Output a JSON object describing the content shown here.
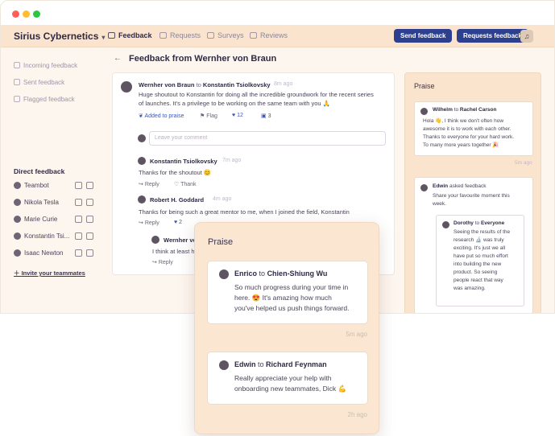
{
  "colors": {
    "accent": "#2d3f8f",
    "nav_bg": "#fbe4cd",
    "page_bg": "#fdf6ef",
    "window_dots": [
      "#ff5f57",
      "#febc2e",
      "#28c840"
    ]
  },
  "topnav": {
    "brand": "Sirius Cybernetics",
    "items": [
      {
        "label": "Feedback",
        "icon": "chat-icon"
      },
      {
        "label": "Requests",
        "icon": "cube-icon"
      },
      {
        "label": "Surveys",
        "icon": "survey-icon"
      },
      {
        "label": "Reviews",
        "icon": "list-icon"
      }
    ],
    "send_feedback": "Send feedback",
    "requests_feedback": "Requests feedback"
  },
  "sidebar": {
    "items": [
      {
        "label": "Incoming feedback",
        "icon": "inbox-icon"
      },
      {
        "label": "Sent feedback",
        "icon": "send-icon"
      },
      {
        "label": "Flagged feedback",
        "icon": "flag-icon"
      }
    ],
    "direct_heading": "Direct feedback",
    "people": [
      "Teambot",
      "Nikola Tesla",
      "Marie Curie",
      "Konstantin Tsi...",
      "Isaac Newton"
    ],
    "invite": "Invite your teammates"
  },
  "main": {
    "title": "Feedback from Wernher von Braun",
    "post": {
      "author": "Wernher von Braun",
      "to_word": "to",
      "recipient": "Konstantin Tsiolkovsky",
      "time": "8m ago",
      "text_line1": "Huge shoutout to Konstantin for doing all the incredible groundwork for the recent series",
      "text_line2": "of launches. It's a privilege to be working on the same team with you 🙏",
      "added": "Added to praise",
      "flag": "Flag",
      "likes": "12",
      "comments": "3"
    },
    "comment_placeholder": "Leave your comment",
    "replies": [
      {
        "author": "Konstantin Tsiolkovsky",
        "time": "7m ago",
        "text": "Thanks for the shoutout 😊",
        "reply": "Reply",
        "thank": "Thank",
        "likes": ""
      },
      {
        "author": "Robert H. Goddard",
        "time": "4m ago",
        "text": "Thanks for being such a great mentor to me, when I joined the field, Konstantin",
        "reply": "Reply",
        "thank": "",
        "likes": "2"
      },
      {
        "author": "Wernher von",
        "time": "",
        "text": "I think at least half",
        "reply": "Reply",
        "thank": "",
        "likes": ""
      }
    ]
  },
  "right_panel": {
    "title": "Praise",
    "card1": {
      "from": "Wilhelm",
      "to_word": "to",
      "to": "Rachel Carson",
      "lines": [
        "Hola 👋, I think we don't often how",
        "awesome it is to work with each other.",
        "Thanks to everyone for your hard work.",
        "To many more years together 🎉"
      ],
      "time": "5m ago"
    },
    "card2": {
      "from": "Edwin",
      "action": "asked feedback",
      "subtitle_lines": [
        "Share your favourite moment this",
        "week."
      ],
      "inner_from": "Dorothy",
      "inner_to_word": "to",
      "inner_to": "Everyone",
      "inner_lines": [
        "Seeing the results of the",
        "research 🔬 was truly",
        "exciting. It's just we all",
        "have put so much effort",
        "into building the new",
        "product. So seeing",
        "people react that way",
        "was amazing."
      ]
    }
  },
  "popup": {
    "title": "Praise",
    "cards": [
      {
        "from": "Enrico",
        "to_word": "to",
        "to": "Chien-Shiung Wu",
        "lines": [
          "So much progress during your time in",
          "here. 😍 It's amazing how much",
          "you've helped us push things forward."
        ],
        "time": "5m ago"
      },
      {
        "from": "Edwin",
        "to_word": "to",
        "to": "Richard Feynman",
        "lines": [
          "Really appreciate your help with",
          "onboarding new teammates, Dick 💪"
        ],
        "time": "2h ago"
      }
    ]
  }
}
